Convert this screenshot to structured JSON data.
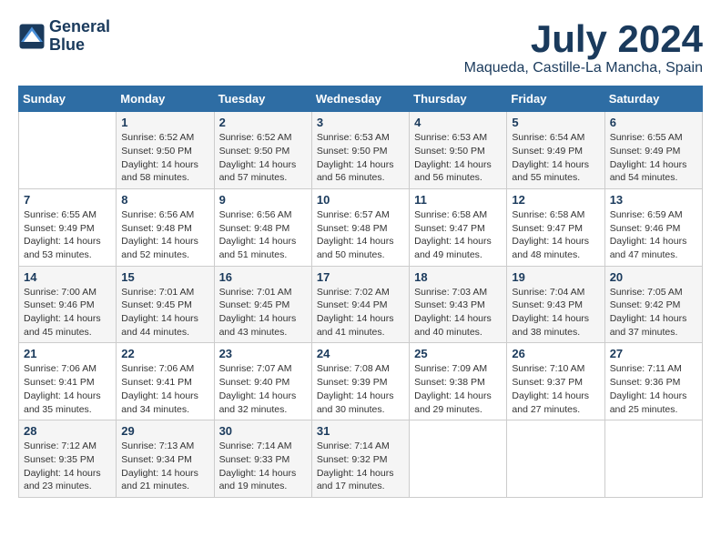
{
  "logo": {
    "line1": "General",
    "line2": "Blue"
  },
  "title": "July 2024",
  "location": "Maqueda, Castille-La Mancha, Spain",
  "headers": [
    "Sunday",
    "Monday",
    "Tuesday",
    "Wednesday",
    "Thursday",
    "Friday",
    "Saturday"
  ],
  "weeks": [
    [
      {
        "day": "",
        "info": ""
      },
      {
        "day": "1",
        "info": "Sunrise: 6:52 AM\nSunset: 9:50 PM\nDaylight: 14 hours\nand 58 minutes."
      },
      {
        "day": "2",
        "info": "Sunrise: 6:52 AM\nSunset: 9:50 PM\nDaylight: 14 hours\nand 57 minutes."
      },
      {
        "day": "3",
        "info": "Sunrise: 6:53 AM\nSunset: 9:50 PM\nDaylight: 14 hours\nand 56 minutes."
      },
      {
        "day": "4",
        "info": "Sunrise: 6:53 AM\nSunset: 9:50 PM\nDaylight: 14 hours\nand 56 minutes."
      },
      {
        "day": "5",
        "info": "Sunrise: 6:54 AM\nSunset: 9:49 PM\nDaylight: 14 hours\nand 55 minutes."
      },
      {
        "day": "6",
        "info": "Sunrise: 6:55 AM\nSunset: 9:49 PM\nDaylight: 14 hours\nand 54 minutes."
      }
    ],
    [
      {
        "day": "7",
        "info": "Sunrise: 6:55 AM\nSunset: 9:49 PM\nDaylight: 14 hours\nand 53 minutes."
      },
      {
        "day": "8",
        "info": "Sunrise: 6:56 AM\nSunset: 9:48 PM\nDaylight: 14 hours\nand 52 minutes."
      },
      {
        "day": "9",
        "info": "Sunrise: 6:56 AM\nSunset: 9:48 PM\nDaylight: 14 hours\nand 51 minutes."
      },
      {
        "day": "10",
        "info": "Sunrise: 6:57 AM\nSunset: 9:48 PM\nDaylight: 14 hours\nand 50 minutes."
      },
      {
        "day": "11",
        "info": "Sunrise: 6:58 AM\nSunset: 9:47 PM\nDaylight: 14 hours\nand 49 minutes."
      },
      {
        "day": "12",
        "info": "Sunrise: 6:58 AM\nSunset: 9:47 PM\nDaylight: 14 hours\nand 48 minutes."
      },
      {
        "day": "13",
        "info": "Sunrise: 6:59 AM\nSunset: 9:46 PM\nDaylight: 14 hours\nand 47 minutes."
      }
    ],
    [
      {
        "day": "14",
        "info": "Sunrise: 7:00 AM\nSunset: 9:46 PM\nDaylight: 14 hours\nand 45 minutes."
      },
      {
        "day": "15",
        "info": "Sunrise: 7:01 AM\nSunset: 9:45 PM\nDaylight: 14 hours\nand 44 minutes."
      },
      {
        "day": "16",
        "info": "Sunrise: 7:01 AM\nSunset: 9:45 PM\nDaylight: 14 hours\nand 43 minutes."
      },
      {
        "day": "17",
        "info": "Sunrise: 7:02 AM\nSunset: 9:44 PM\nDaylight: 14 hours\nand 41 minutes."
      },
      {
        "day": "18",
        "info": "Sunrise: 7:03 AM\nSunset: 9:43 PM\nDaylight: 14 hours\nand 40 minutes."
      },
      {
        "day": "19",
        "info": "Sunrise: 7:04 AM\nSunset: 9:43 PM\nDaylight: 14 hours\nand 38 minutes."
      },
      {
        "day": "20",
        "info": "Sunrise: 7:05 AM\nSunset: 9:42 PM\nDaylight: 14 hours\nand 37 minutes."
      }
    ],
    [
      {
        "day": "21",
        "info": "Sunrise: 7:06 AM\nSunset: 9:41 PM\nDaylight: 14 hours\nand 35 minutes."
      },
      {
        "day": "22",
        "info": "Sunrise: 7:06 AM\nSunset: 9:41 PM\nDaylight: 14 hours\nand 34 minutes."
      },
      {
        "day": "23",
        "info": "Sunrise: 7:07 AM\nSunset: 9:40 PM\nDaylight: 14 hours\nand 32 minutes."
      },
      {
        "day": "24",
        "info": "Sunrise: 7:08 AM\nSunset: 9:39 PM\nDaylight: 14 hours\nand 30 minutes."
      },
      {
        "day": "25",
        "info": "Sunrise: 7:09 AM\nSunset: 9:38 PM\nDaylight: 14 hours\nand 29 minutes."
      },
      {
        "day": "26",
        "info": "Sunrise: 7:10 AM\nSunset: 9:37 PM\nDaylight: 14 hours\nand 27 minutes."
      },
      {
        "day": "27",
        "info": "Sunrise: 7:11 AM\nSunset: 9:36 PM\nDaylight: 14 hours\nand 25 minutes."
      }
    ],
    [
      {
        "day": "28",
        "info": "Sunrise: 7:12 AM\nSunset: 9:35 PM\nDaylight: 14 hours\nand 23 minutes."
      },
      {
        "day": "29",
        "info": "Sunrise: 7:13 AM\nSunset: 9:34 PM\nDaylight: 14 hours\nand 21 minutes."
      },
      {
        "day": "30",
        "info": "Sunrise: 7:14 AM\nSunset: 9:33 PM\nDaylight: 14 hours\nand 19 minutes."
      },
      {
        "day": "31",
        "info": "Sunrise: 7:14 AM\nSunset: 9:32 PM\nDaylight: 14 hours\nand 17 minutes."
      },
      {
        "day": "",
        "info": ""
      },
      {
        "day": "",
        "info": ""
      },
      {
        "day": "",
        "info": ""
      }
    ]
  ]
}
